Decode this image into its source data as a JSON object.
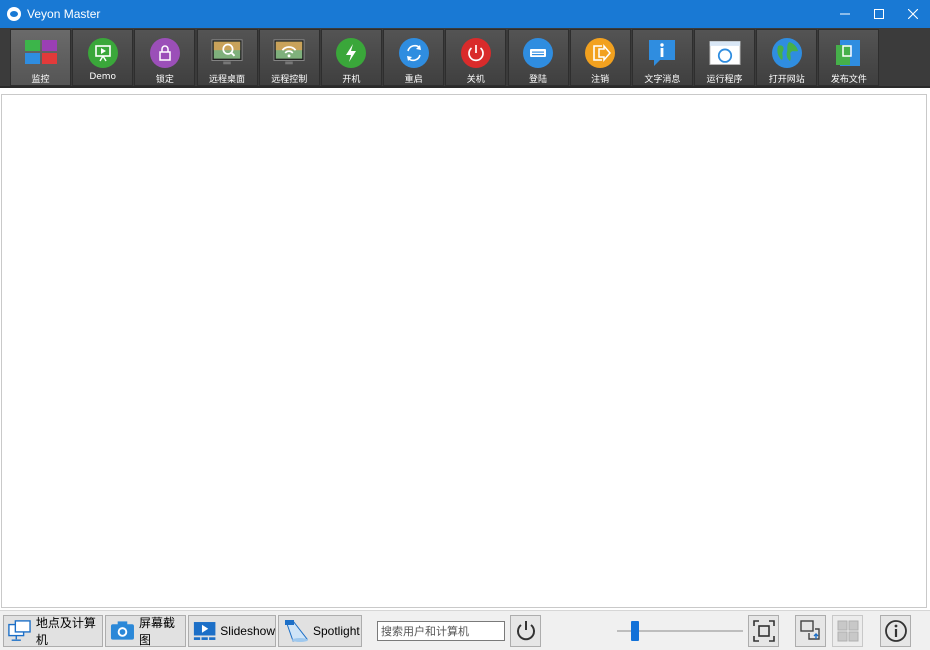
{
  "window": {
    "title": "Veyon Master",
    "accent": "#1979d4"
  },
  "toolbar": {
    "items": [
      {
        "label": "监控",
        "icon": "monitor-tiles-icon",
        "active": true
      },
      {
        "label": "Demo",
        "icon": "demo-presentation-icon"
      },
      {
        "label": "锁定",
        "icon": "lock-icon"
      },
      {
        "label": "远程桌面",
        "icon": "remote-view-icon"
      },
      {
        "label": "远程控制",
        "icon": "remote-control-icon"
      },
      {
        "label": "开机",
        "icon": "power-on-icon"
      },
      {
        "label": "重启",
        "icon": "reboot-icon"
      },
      {
        "label": "关机",
        "icon": "power-off-icon"
      },
      {
        "label": "登陆",
        "icon": "login-icon"
      },
      {
        "label": "注销",
        "icon": "logout-icon"
      },
      {
        "label": "文字消息",
        "icon": "text-message-icon"
      },
      {
        "label": "运行程序",
        "icon": "run-program-icon"
      },
      {
        "label": "打开网站",
        "icon": "open-website-icon"
      },
      {
        "label": "发布文件",
        "icon": "transfer-file-icon"
      }
    ]
  },
  "bottombar": {
    "locations_label": "地点及计算机",
    "screenshot_label": "屏幕截图",
    "slideshow_label": "Slideshow",
    "spotlight_label": "Spotlight",
    "search_placeholder": "搜索用户和计算机",
    "zoom_level": 0.12
  }
}
